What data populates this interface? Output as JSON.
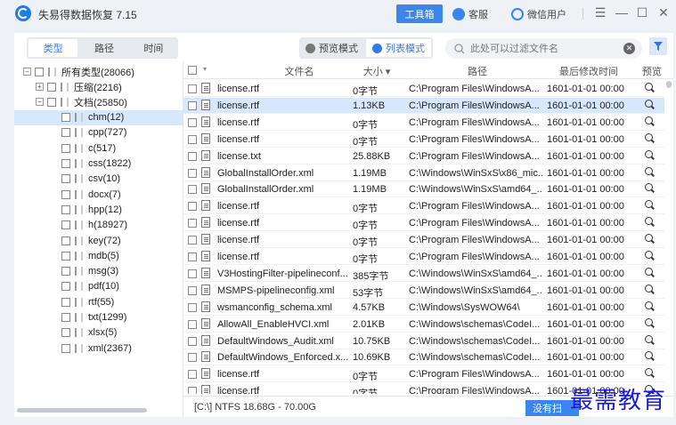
{
  "app": {
    "title": "失易得数据恢复 7.15",
    "tools_label": "工具箱",
    "service_label": "客服",
    "wechat_label": "微信用户",
    "window_controls": [
      "☰",
      "—",
      "☐",
      "✕"
    ]
  },
  "toolbar": {
    "tabs": [
      "类型",
      "路径",
      "时间"
    ],
    "active_tab": "类型",
    "modes": [
      "预览模式",
      "列表模式"
    ],
    "active_mode": "列表模式",
    "search_placeholder": "此处可以过滤文件名",
    "clear_icon": "✕",
    "filter_icon": "filter-icon"
  },
  "tree": {
    "root": "所有类型(28066)",
    "nodes": [
      {
        "label": "压缩(2216)",
        "level": 1,
        "expand": "+"
      },
      {
        "label": "文档(25850)",
        "level": 1,
        "expand": "−"
      },
      {
        "label": "chm(12)",
        "level": 2,
        "selected": true
      },
      {
        "label": "cpp(727)",
        "level": 2
      },
      {
        "label": "c(517)",
        "level": 2
      },
      {
        "label": "css(1822)",
        "level": 2
      },
      {
        "label": "csv(10)",
        "level": 2
      },
      {
        "label": "docx(7)",
        "level": 2
      },
      {
        "label": "hpp(12)",
        "level": 2
      },
      {
        "label": "h(18927)",
        "level": 2
      },
      {
        "label": "key(72)",
        "level": 2
      },
      {
        "label": "mdb(5)",
        "level": 2
      },
      {
        "label": "msg(3)",
        "level": 2
      },
      {
        "label": "pdf(10)",
        "level": 2
      },
      {
        "label": "rtf(55)",
        "level": 2
      },
      {
        "label": "txt(1299)",
        "level": 2
      },
      {
        "label": "xlsx(5)",
        "level": 2
      },
      {
        "label": "xml(2367)",
        "level": 2
      }
    ]
  },
  "table": {
    "headers": {
      "name": "文件名",
      "size": "大小 ▾",
      "path": "路径",
      "modified": "最后修改时间",
      "preview": "预览"
    },
    "rows": [
      {
        "name": "license.rtf",
        "size": "0字节",
        "path": "C:\\Program Files\\WindowsA...",
        "modified": "1601-01-01  00:00"
      },
      {
        "name": "license.rtf",
        "size": "1.13KB",
        "path": "C:\\Program Files\\WindowsA...",
        "modified": "1601-01-01  00:00",
        "selected": true
      },
      {
        "name": "license.rtf",
        "size": "0字节",
        "path": "C:\\Program Files\\WindowsA...",
        "modified": "1601-01-01  00:00"
      },
      {
        "name": "license.rtf",
        "size": "0字节",
        "path": "C:\\Program Files\\WindowsA...",
        "modified": "1601-01-01  00:00"
      },
      {
        "name": "license.txt",
        "size": "25.88KB",
        "path": "C:\\Program Files\\WindowsA...",
        "modified": "1601-01-01  00:00"
      },
      {
        "name": "GlobalInstallOrder.xml",
        "size": "1.19MB",
        "path": "C:\\Windows\\WinSxS\\x86_mic...",
        "modified": "1601-01-01  00:00"
      },
      {
        "name": "GlobalInstallOrder.xml",
        "size": "1.19MB",
        "path": "C:\\Windows\\WinSxS\\amd64_...",
        "modified": "1601-01-01  00:00"
      },
      {
        "name": "license.rtf",
        "size": "0字节",
        "path": "C:\\Program Files\\WindowsA...",
        "modified": "1601-01-01  00:00"
      },
      {
        "name": "license.rtf",
        "size": "0字节",
        "path": "C:\\Program Files\\WindowsA...",
        "modified": "1601-01-01  00:00"
      },
      {
        "name": "license.rtf",
        "size": "0字节",
        "path": "C:\\Program Files\\WindowsA...",
        "modified": "1601-01-01  00:00"
      },
      {
        "name": "license.rtf",
        "size": "0字节",
        "path": "C:\\Program Files\\WindowsA...",
        "modified": "1601-01-01  00:00"
      },
      {
        "name": "V3HostingFilter-pipelineconf...",
        "size": "385字节",
        "path": "C:\\Windows\\WinSxS\\amd64_...",
        "modified": "1601-01-01  00:00"
      },
      {
        "name": "MSMPS-pipelineconfig.xml",
        "size": "53字节",
        "path": "C:\\Windows\\WinSxS\\amd64_...",
        "modified": "1601-01-01  00:00"
      },
      {
        "name": "wsmanconfig_schema.xml",
        "size": "4.57KB",
        "path": "C:\\Windows\\SysWOW64\\",
        "modified": "1601-01-01  00:00"
      },
      {
        "name": "AllowAll_EnableHVCI.xml",
        "size": "2.01KB",
        "path": "C:\\Windows\\schemas\\CodeI...",
        "modified": "1601-01-01  00:00"
      },
      {
        "name": "DefaultWindows_Audit.xml",
        "size": "10.75KB",
        "path": "C:\\Windows\\schemas\\CodeI...",
        "modified": "1601-01-01  00:00"
      },
      {
        "name": "DefaultWindows_Enforced.x...",
        "size": "10.69KB",
        "path": "C:\\Windows\\schemas\\CodeI...",
        "modified": "1601-01-01  00:00"
      },
      {
        "name": "license.rtf",
        "size": "0字节",
        "path": "C:\\Program Files\\WindowsA...",
        "modified": "1601-01-01  00:00"
      },
      {
        "name": "license.rtf",
        "size": "0字节",
        "path": "C:\\Program Files\\WindowsA...",
        "modified": "1601-01-01  00:00"
      }
    ]
  },
  "status": {
    "text": "[C:\\] NTFS 18.68G - 70.00G",
    "recover_label": "没有扫"
  },
  "watermark": "最需教育",
  "colors": {
    "accent": "#3a86ec",
    "selection": "#d8e8fc"
  }
}
